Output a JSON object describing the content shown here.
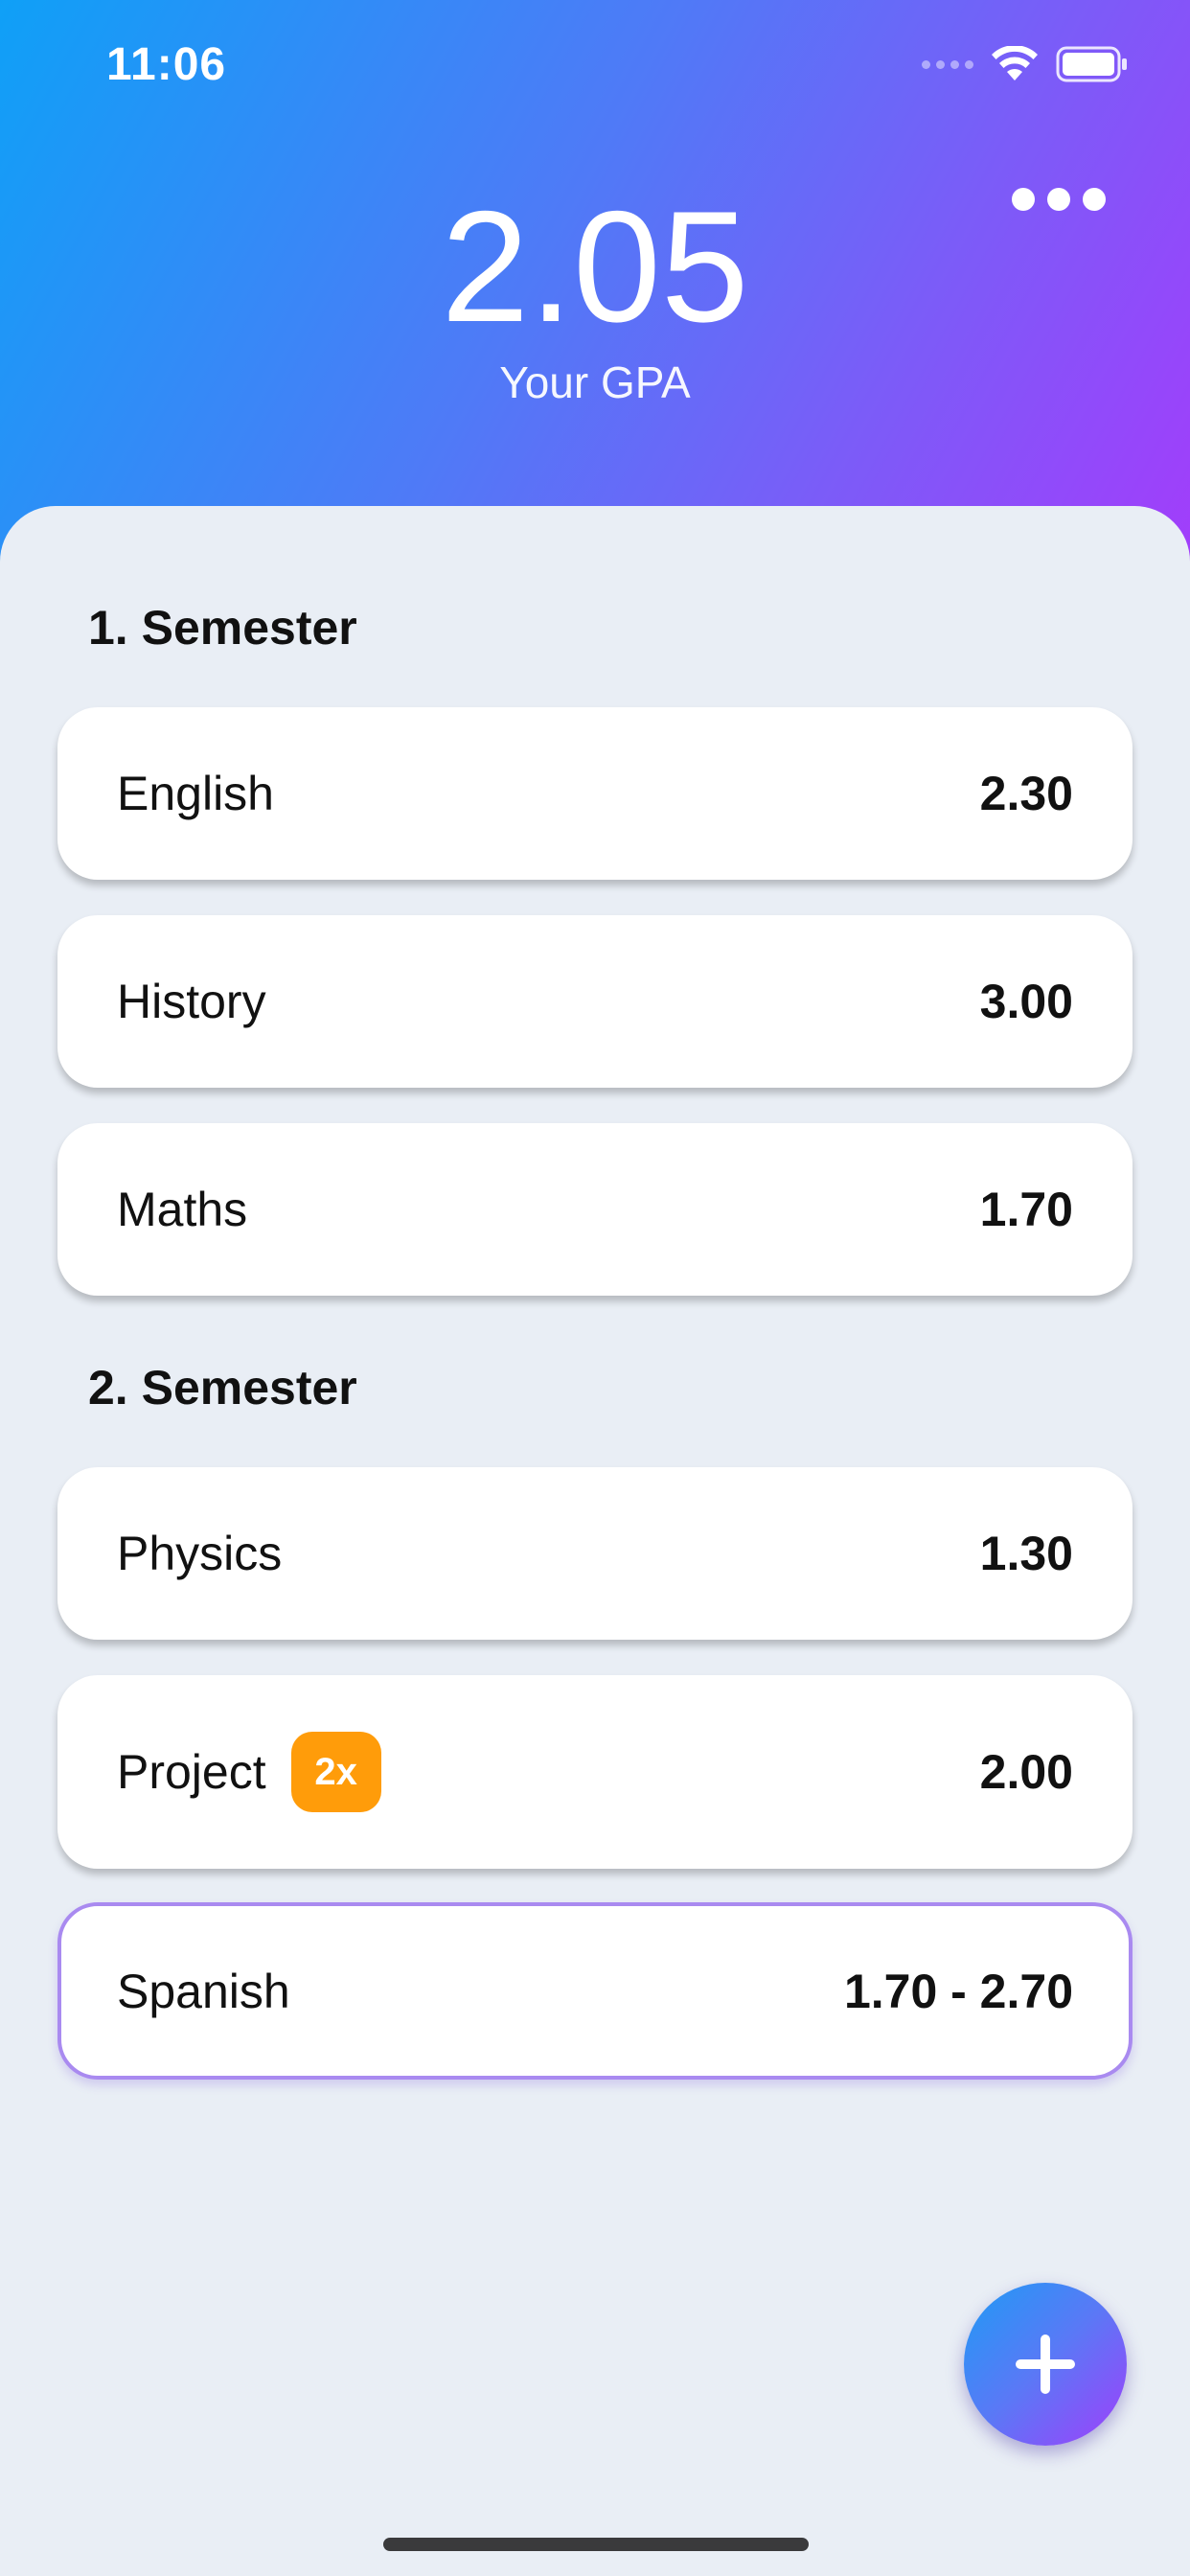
{
  "status_bar": {
    "time": "11:06"
  },
  "header": {
    "gpa_value": "2.05",
    "gpa_label": "Your GPA",
    "more_icon": "more-horizontal-icon"
  },
  "sections": [
    {
      "title": "1. Semester",
      "courses": [
        {
          "name": "English",
          "grade": "2.30"
        },
        {
          "name": "History",
          "grade": "3.00"
        },
        {
          "name": "Maths",
          "grade": "1.70"
        }
      ]
    },
    {
      "title": "2. Semester",
      "courses": [
        {
          "name": "Physics",
          "grade": "1.30"
        },
        {
          "name": "Project",
          "grade": "2.00",
          "badge": "2x"
        },
        {
          "name": "Spanish",
          "grade": "1.70 - 2.70",
          "selected": true
        }
      ]
    }
  ],
  "fab": {
    "icon": "plus-icon"
  },
  "colors": {
    "gradient_start": "#0fa0f7",
    "gradient_end": "#a33cfb",
    "badge": "#ff9c0a",
    "selected_border": "#a98af0",
    "background": "#e9eef5"
  }
}
